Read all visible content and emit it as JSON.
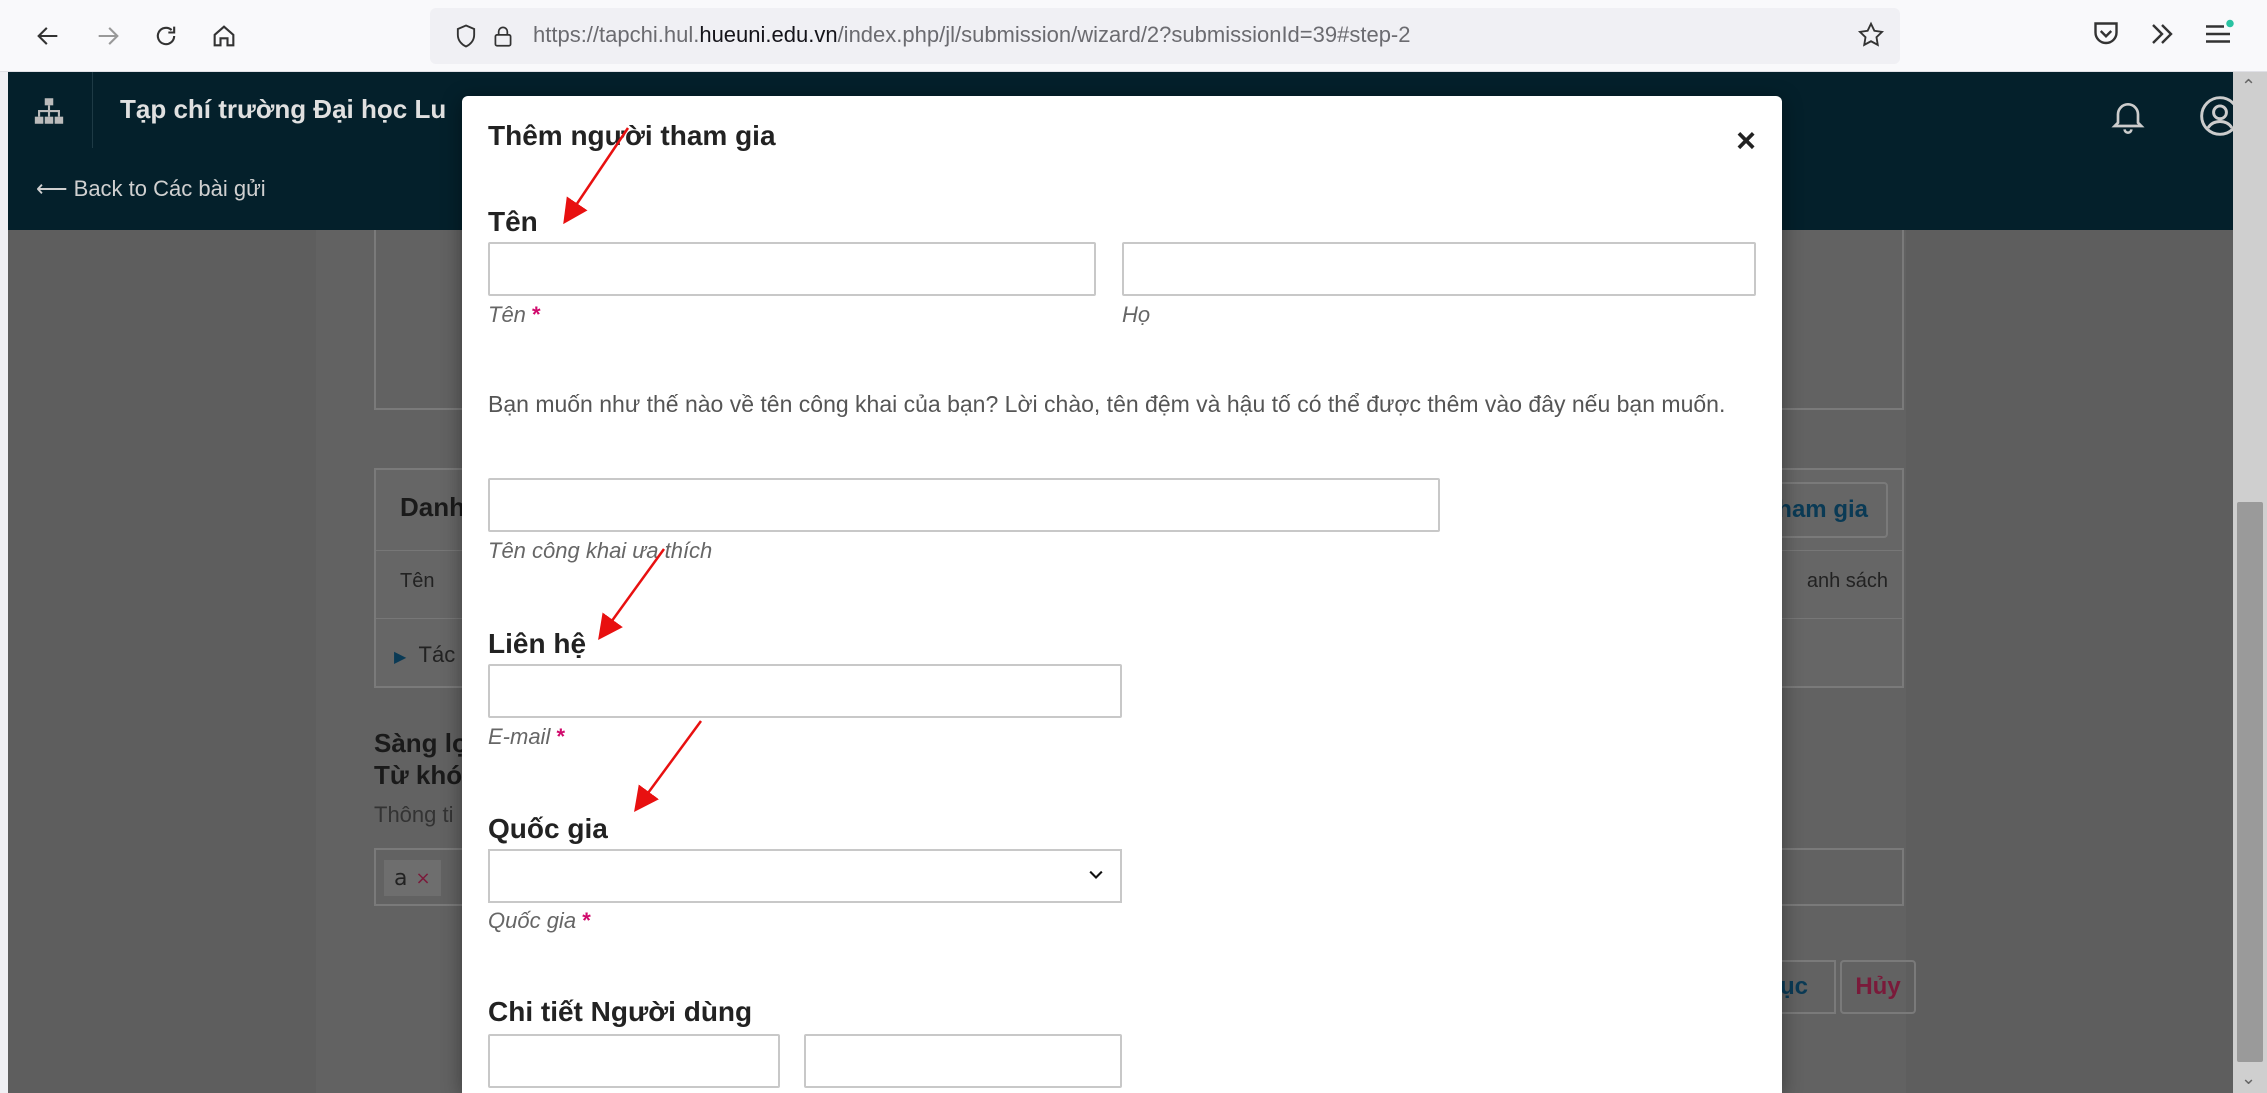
{
  "browser": {
    "url_prefix": "https://tapchi.hul.",
    "url_domain": "hueuni.edu.vn",
    "url_suffix": "/index.php/jl/submission/wizard/2?submissionId=39#step-2"
  },
  "header": {
    "title": "Tạp chí trường Đại học Lu",
    "back_link": "⟵ Back to Các bài gửi"
  },
  "background": {
    "contributors_title": "Danh",
    "add_contributor": "ham gia",
    "col_name": "Tên",
    "col_list": "anh sách",
    "row_author": "Tác",
    "filter_title1": "Sàng lọ",
    "filter_title2": "Từ khó",
    "filter_info": "Thông ti",
    "tag_a": "a",
    "tag_x": "×",
    "btn_continue": "ục",
    "btn_cancel": "Hủy"
  },
  "modal": {
    "title": "Thêm người tham gia",
    "close": "×",
    "name_section": "Tên",
    "given_name_label": "Tên",
    "family_name_label": "Họ",
    "required_mark": "*",
    "preferred_desc": "Bạn muốn như thế nào về tên công khai của bạn? Lời chào, tên đệm và hậu tố có thể được thêm vào đây nếu bạn muốn.",
    "preferred_label": "Tên công khai ưa thích",
    "contact_section": "Liên hệ",
    "email_label": "E-mail",
    "country_section": "Quốc gia",
    "country_label": "Quốc gia",
    "user_details_section": "Chi tiết Người dùng"
  },
  "colors": {
    "required": "#d00a6c",
    "header_bg": "#04202b",
    "arrow": "#e81010"
  }
}
